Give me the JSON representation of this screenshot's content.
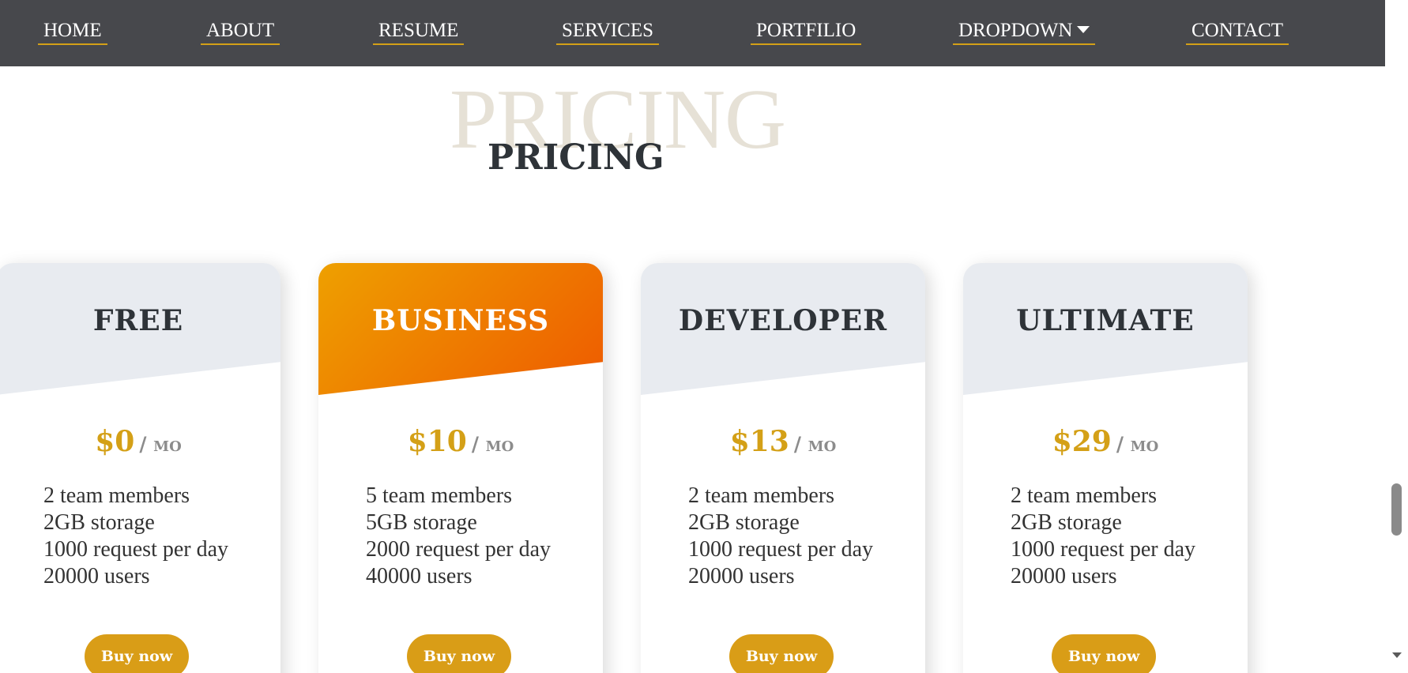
{
  "nav": {
    "items": [
      {
        "label": "HOME"
      },
      {
        "label": "ABOUT"
      },
      {
        "label": "RESUME"
      },
      {
        "label": "SERVICES"
      },
      {
        "label": "PORTFILIO"
      },
      {
        "label": "DROPDOWN"
      },
      {
        "label": "CONTACT"
      }
    ]
  },
  "section": {
    "title_bg": "PRICING",
    "title": "PRICING"
  },
  "plans": [
    {
      "name": "FREE",
      "price": "$0",
      "period": "/ mo",
      "features": [
        "2 team members",
        "2GB storage",
        "1000 request per day",
        "20000 users"
      ],
      "button": "Buy now"
    },
    {
      "name": "BUSINESS",
      "price": "$10",
      "period": "/ mo",
      "features": [
        "5 team members",
        "5GB storage",
        "2000 request per day",
        "40000 users"
      ],
      "button": "Buy now"
    },
    {
      "name": "DEVELOPER",
      "price": "$13",
      "period": "/ mo",
      "features": [
        "2 team members",
        "2GB storage",
        "1000 request per day",
        "20000 users"
      ],
      "button": "Buy now"
    },
    {
      "name": "ULTIMATE",
      "price": "$29",
      "period": "/ mo",
      "features": [
        "2 team members",
        "2GB storage",
        "1000 request per day",
        "20000 users"
      ],
      "button": "Buy now"
    }
  ],
  "colors": {
    "nav_bg": "#47484c",
    "accent": "#d4a017",
    "button": "#d99d17",
    "featured_gradient_start": "#eea000",
    "featured_gradient_end": "#ee5a00",
    "card_head": "#e8ebf0",
    "title_bg_text": "#e6e1d6",
    "title_text": "#2e3338"
  },
  "icons": {
    "dropdown": "caret-down-icon"
  }
}
